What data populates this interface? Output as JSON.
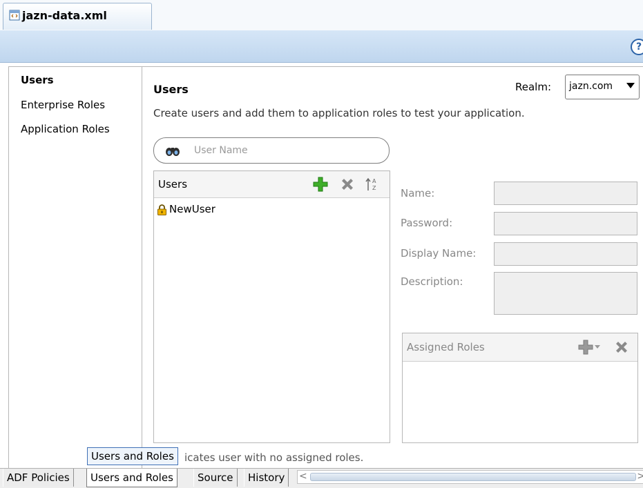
{
  "document_tab": {
    "title": "jazn-data.xml",
    "icon": "xml-file-icon"
  },
  "help": {
    "label": "?"
  },
  "nav": {
    "items": [
      {
        "label": "Users",
        "selected": true
      },
      {
        "label": "Enterprise Roles",
        "selected": false
      },
      {
        "label": "Application Roles",
        "selected": false
      }
    ]
  },
  "main": {
    "title": "Users",
    "description": "Create users and add them to application roles to test your application.",
    "realm_label": "Realm:",
    "realm_value": "jazn.com",
    "search_placeholder": "User Name"
  },
  "users_panel": {
    "header": "Users",
    "items": [
      {
        "name": "NewUser",
        "icon": "lock-icon"
      }
    ]
  },
  "details": {
    "name_label": "Name:",
    "password_label": "Password:",
    "display_name_label": "Display Name:",
    "description_label": "Description:"
  },
  "assigned_roles": {
    "header": "Assigned Roles"
  },
  "legend_text": "icates user with no assigned roles.",
  "tooltip": "Users and Roles",
  "bottom_tabs": [
    {
      "label": "ADF Policies",
      "selected": false
    },
    {
      "label": "Users and Roles",
      "selected": true
    },
    {
      "label": "Source",
      "selected": false
    },
    {
      "label": "History",
      "selected": false
    }
  ],
  "colors": {
    "add_green": "#3fae2a",
    "delete_gray": "#8a8a8a",
    "tab_blue": "#c5daf0"
  }
}
